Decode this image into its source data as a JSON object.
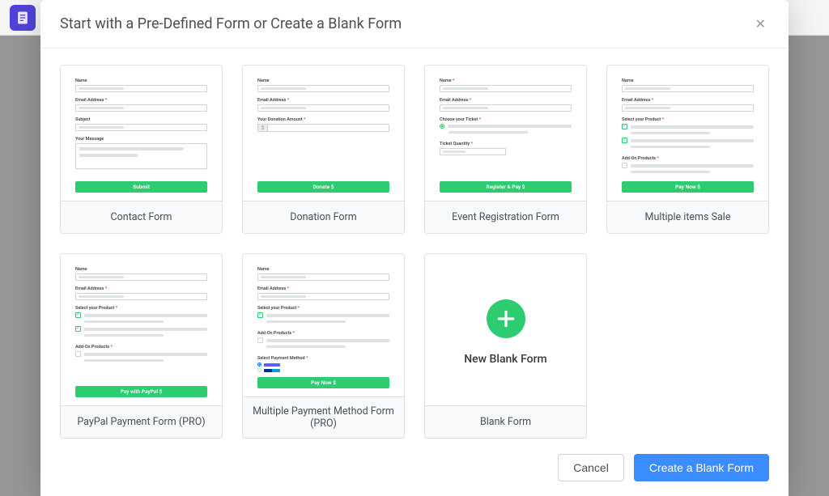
{
  "modal": {
    "title": "Start with a Pre-Defined Form or Create a Blank Form",
    "actions": {
      "cancel": "Cancel",
      "create": "Create a Blank Form"
    }
  },
  "templates": [
    {
      "title": "Contact Form",
      "fields": {
        "name": "Name",
        "email": "Email Address",
        "subject": "Subject",
        "message": "Your Message"
      },
      "button": "Submit"
    },
    {
      "title": "Donation Form",
      "fields": {
        "name": "Name",
        "email": "Email Address",
        "amount": "Your Donation Amount",
        "currency": "$"
      },
      "button": "Donate $"
    },
    {
      "title": "Event Registration Form",
      "fields": {
        "name": "Name",
        "email": "Email Address",
        "ticket": "Choose your Ticket",
        "qty": "Ticket Quantity"
      },
      "button": "Register & Pay $"
    },
    {
      "title": "Multiple items Sale",
      "fields": {
        "name": "Name",
        "email": "Email Address",
        "product": "Select your Product",
        "addons": "Add-On Products"
      },
      "button": "Pay Now $"
    },
    {
      "title": "PayPal Payment Form (PRO)",
      "fields": {
        "name": "Name",
        "email": "Email Address",
        "product": "Select your Product",
        "addons": "Add-On Products"
      },
      "button": "Pay with PayPal $"
    },
    {
      "title": "Multiple Payment Method Form (PRO)",
      "fields": {
        "name": "Name",
        "email": "Email Address",
        "product": "Select your Product",
        "addons": "Add-On Products",
        "method": "Select Payment Method",
        "stripe": "stripe",
        "paypal": "PayPal"
      },
      "button": "Pay Now $"
    },
    {
      "title": "Blank Form",
      "blank_label": "New Blank Form"
    }
  ]
}
